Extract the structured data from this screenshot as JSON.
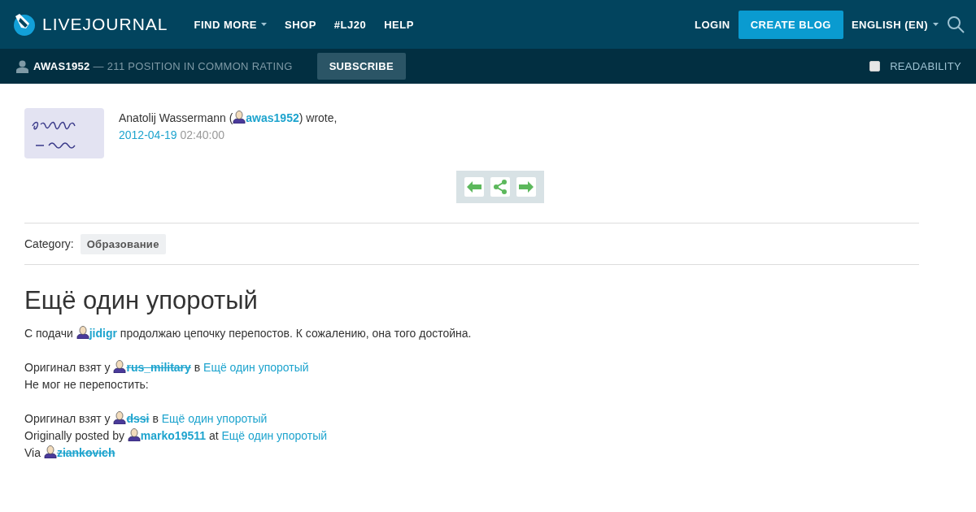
{
  "header": {
    "logo": "LIVEJOURNAL",
    "nav": [
      {
        "label": "FIND MORE",
        "dropdown": true
      },
      {
        "label": "SHOP",
        "dropdown": false
      },
      {
        "label": "#LJ20",
        "dropdown": false
      },
      {
        "label": "HELP",
        "dropdown": false
      }
    ],
    "login": "LOGIN",
    "create": "CREATE BLOG",
    "language": {
      "label": "ENGLISH (EN)",
      "dropdown": true
    }
  },
  "subbar": {
    "user": "AWAS1952",
    "rating": "— 211 POSITION IN COMMON RATING",
    "subscribe": "SUBSCRIBE",
    "readability": {
      "label": "READABILITY",
      "checked": false
    }
  },
  "entry": {
    "author": [
      {
        "kind": "text",
        "text": "Anatolij Wassermann ("
      },
      {
        "kind": "user",
        "name": "awas1952",
        "deleted": false
      },
      {
        "kind": "text",
        "text": ") wrote,"
      }
    ],
    "date": "2012-04-19",
    "time": "02:40:00",
    "category_label": "Category:",
    "category": "Образование",
    "title": "Ещё один упоротый",
    "paragraphs": [
      [
        [
          {
            "kind": "text",
            "text": "С подачи "
          },
          {
            "kind": "user",
            "name": "jidigr",
            "deleted": false
          },
          {
            "kind": "text",
            "text": " продолжаю цепочку перепостов. К сожалению, она того достойна."
          }
        ]
      ],
      [
        [
          {
            "kind": "text",
            "text": "Оригинал взят у "
          },
          {
            "kind": "user",
            "name": "rus_military",
            "deleted": true
          },
          {
            "kind": "text",
            "text": " в "
          },
          {
            "kind": "link",
            "text": "Ещё один упоротый"
          }
        ],
        [
          {
            "kind": "text",
            "text": "Не мог не перепостить:"
          }
        ]
      ],
      [
        [
          {
            "kind": "text",
            "text": "Оригинал взят у "
          },
          {
            "kind": "user",
            "name": "dssi",
            "deleted": true
          },
          {
            "kind": "text",
            "text": " в "
          },
          {
            "kind": "link",
            "text": "Ещё один упоротый"
          }
        ],
        [
          {
            "kind": "text",
            "text": "Originally posted by "
          },
          {
            "kind": "user",
            "name": "marko19511",
            "deleted": false
          },
          {
            "kind": "text",
            "text": " at "
          },
          {
            "kind": "link",
            "text": "Ещё один упоротый"
          }
        ],
        [
          {
            "kind": "text",
            "text": "Via "
          },
          {
            "kind": "user",
            "name": "ziankovich",
            "deleted": true
          }
        ]
      ]
    ]
  }
}
